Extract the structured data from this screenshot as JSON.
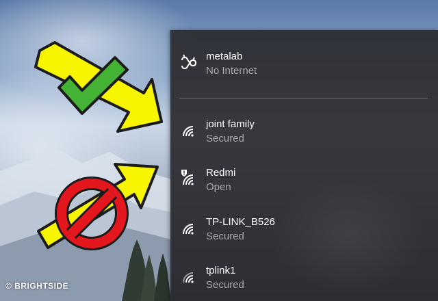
{
  "watermark": "© BRIGHTSIDE",
  "networks": [
    {
      "name": "metalab",
      "status": "No Internet",
      "icon": "ethernet-icon"
    },
    {
      "name": "joint family",
      "status": "Secured",
      "icon": "wifi-signal-icon"
    },
    {
      "name": "Redmi",
      "status": "Open",
      "icon": "wifi-warning-icon"
    },
    {
      "name": "TP-LINK_B526",
      "status": "Secured",
      "icon": "wifi-signal-icon"
    },
    {
      "name": "tplink1",
      "status": "Secured",
      "icon": "wifi-signal-icon"
    }
  ],
  "colors": {
    "panel": "#2c2c30",
    "arrow_yellow": "#f7f500",
    "check_green": "#44b335",
    "forbidden_red": "#e3171d"
  }
}
